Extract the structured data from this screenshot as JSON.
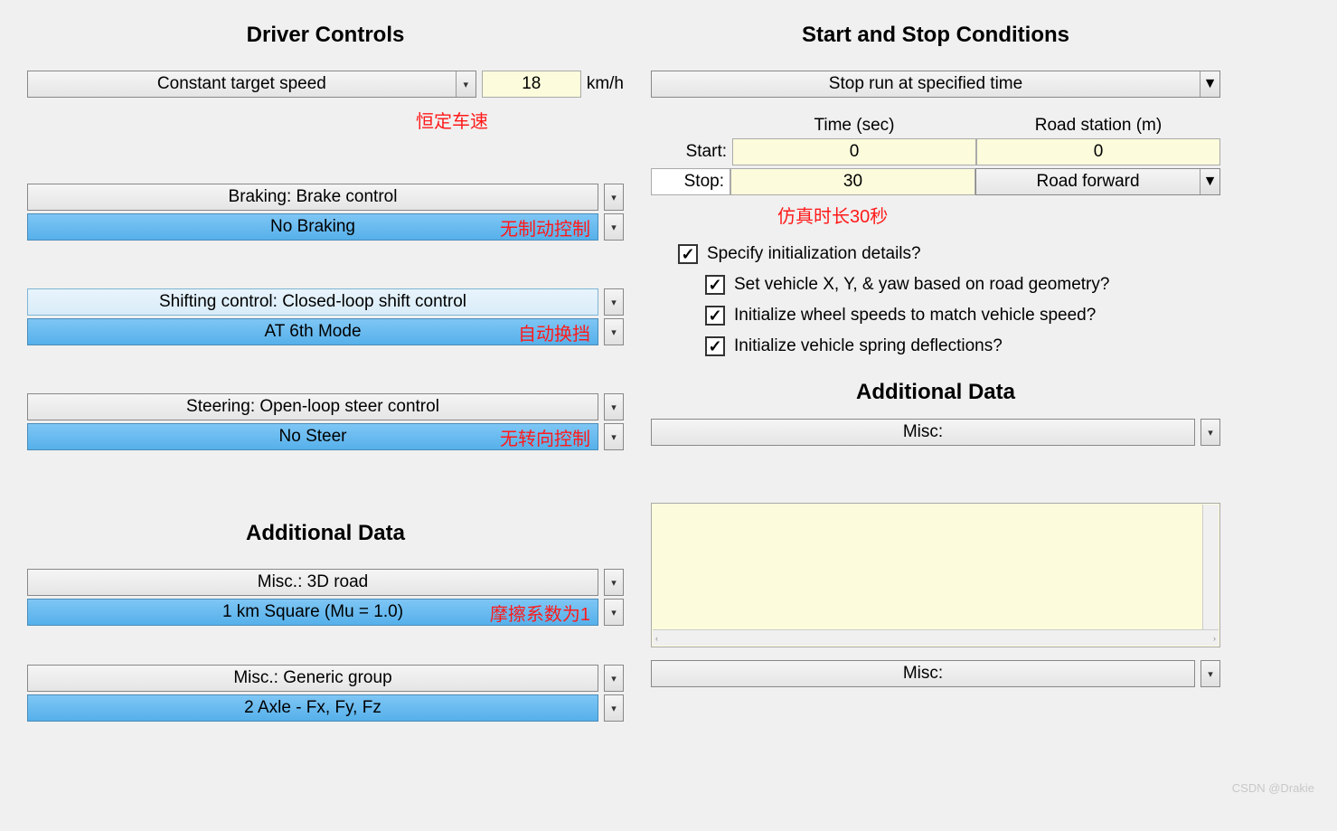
{
  "left": {
    "heading": "Driver Controls",
    "speed_mode": "Constant target speed",
    "speed_value": "18",
    "speed_unit": "km/h",
    "speed_note": "恒定车速",
    "braking_label": "Braking: Brake control",
    "braking_value": "No Braking",
    "braking_note": "无制动控制",
    "shifting_label": "Shifting control: Closed-loop shift control",
    "shifting_value": "AT 6th Mode",
    "shifting_note": "自动换挡",
    "steering_label": "Steering: Open-loop steer control",
    "steering_value": "No Steer",
    "steering_note": "无转向控制",
    "additional_heading": "Additional Data",
    "misc1_label": "Misc.: 3D road",
    "misc1_value": "1 km Square (Mu = 1.0)",
    "misc1_note": "摩擦系数为1",
    "misc2_label": "Misc.: Generic group",
    "misc2_value": "2 Axle - Fx, Fy, Fz"
  },
  "right": {
    "heading": "Start and Stop Conditions",
    "stop_mode": "Stop run at specified time",
    "time_header": "Time (sec)",
    "station_header": "Road station (m)",
    "start_label": "Start:",
    "start_time": "0",
    "start_station": "0",
    "stop_label": "Stop:",
    "stop_time": "30",
    "stop_direction": "Road forward",
    "stop_note": "仿真时长30秒",
    "chk_init": "Specify initialization details?",
    "chk_geom": "Set vehicle X, Y, & yaw based on road geometry?",
    "chk_wheel": "Initialize wheel speeds to match vehicle speed?",
    "chk_spring": "Initialize vehicle spring deflections?",
    "additional_heading": "Additional Data",
    "misc_label": "Misc:",
    "misc_label2": "Misc:"
  },
  "watermark": "CSDN @Drakie"
}
